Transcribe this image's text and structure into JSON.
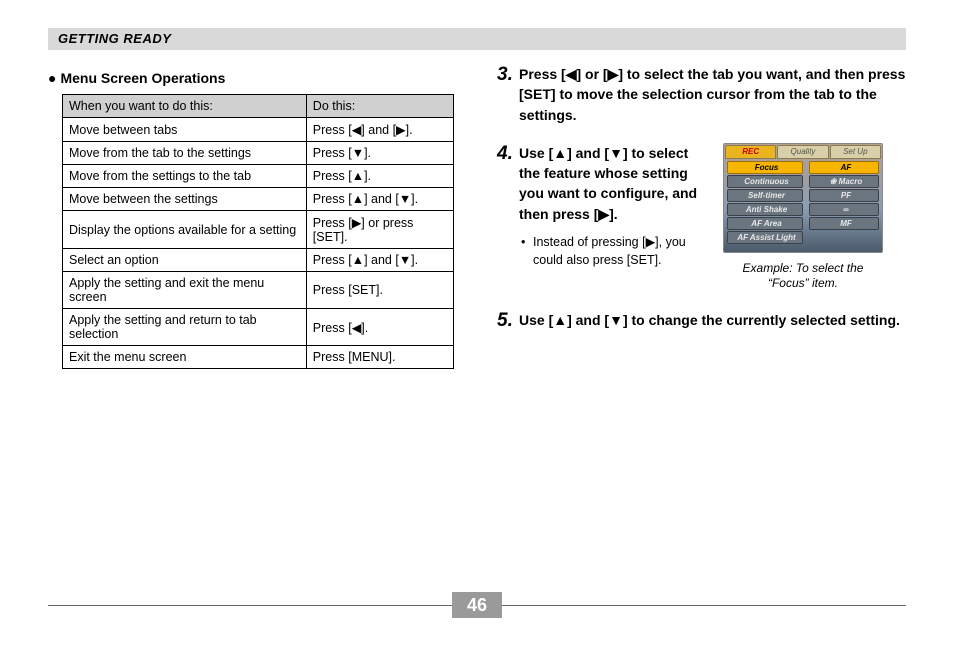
{
  "header": "GETTING READY",
  "subhead": "Menu Screen Operations",
  "table": {
    "head": [
      "When you want to do this:",
      "Do this:"
    ],
    "rows": [
      [
        "Move between tabs",
        "Press [◀] and [▶]."
      ],
      [
        "Move from the tab to the settings",
        "Press [▼]."
      ],
      [
        "Move from the settings to the tab",
        "Press [▲]."
      ],
      [
        "Move between the settings",
        "Press [▲] and [▼]."
      ],
      [
        "Display the options available for a setting",
        "Press [▶] or press [SET]."
      ],
      [
        "Select an option",
        "Press [▲] and [▼]."
      ],
      [
        "Apply the setting and exit the menu screen",
        "Press [SET]."
      ],
      [
        "Apply the setting and return to tab selection",
        "Press [◀]."
      ],
      [
        "Exit the menu screen",
        "Press [MENU]."
      ]
    ]
  },
  "steps": {
    "s3": {
      "num": "3.",
      "text": "Press [◀] or [▶] to select the tab you want, and then press [SET] to move the selection cursor from the tab to the settings."
    },
    "s4": {
      "num": "4.",
      "text": "Use [▲] and [▼] to select the feature whose setting you want to configure, and then press [▶].",
      "note": "Instead of pressing [▶], you could also press [SET].",
      "caption": "Example: To select the “Focus” item."
    },
    "s5": {
      "num": "5.",
      "text": "Use [▲] and [▼] to change the currently selected setting."
    }
  },
  "camera_menu": {
    "tabs": [
      "REC",
      "Quality",
      "Set Up"
    ],
    "active_tab": 0,
    "items": [
      "Focus",
      "Continuous",
      "Self-timer",
      "Anti Shake",
      "AF Area",
      "AF Assist Light"
    ],
    "highlight_item": 0,
    "options": [
      "AF",
      "❀ Macro",
      "PF",
      "∞",
      "MF"
    ],
    "highlight_option": 0
  },
  "page_number": "46"
}
